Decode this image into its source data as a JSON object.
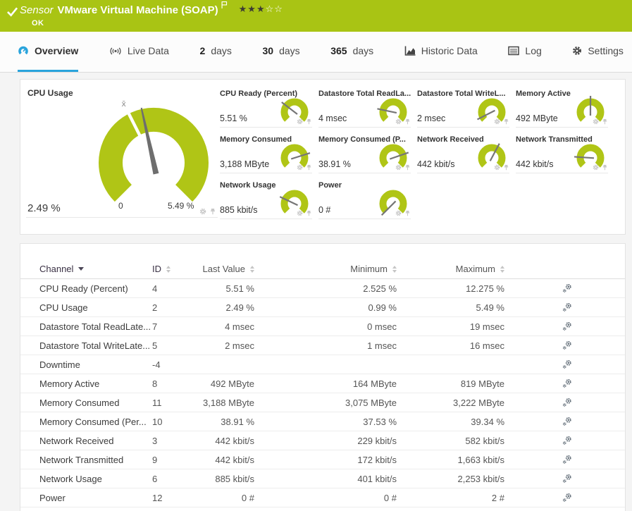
{
  "header": {
    "kind_label": "Sensor",
    "title": "VMware Virtual Machine (SOAP)",
    "status": "OK",
    "stars_filled": "★★★",
    "stars_empty": "☆☆",
    "priority": {
      "filled": 3,
      "total": 5
    }
  },
  "tabs": [
    {
      "label": "Overview",
      "icon": "gauge-icon",
      "active": true
    },
    {
      "label": "Live Data",
      "icon": "broadcast-icon",
      "active": false
    },
    {
      "prefix": "2",
      "label": "days",
      "active": false
    },
    {
      "prefix": "30",
      "label": "days",
      "active": false
    },
    {
      "prefix": "365",
      "label": "days",
      "active": false
    },
    {
      "label": "Historic Data",
      "icon": "area-chart-icon",
      "active": false
    },
    {
      "label": "Log",
      "icon": "log-icon",
      "active": false
    },
    {
      "label": "Settings",
      "icon": "gear-icon",
      "active": false
    }
  ],
  "gauges": {
    "main": {
      "label": "CPU Usage",
      "value": "2.49 %",
      "value_num": 2.49,
      "min": 0,
      "max": 5.49,
      "min_label": "0",
      "max_label": "5.49 %",
      "mean": 2.2,
      "mean_label": "x̄"
    },
    "minis": [
      {
        "label": "CPU Ready (Percent)",
        "value": "5.51 %",
        "value_num": 5.51,
        "min": 2.525,
        "max": 12.275
      },
      {
        "label": "Datastore Total ReadLa...",
        "value": "4 msec",
        "value_num": 4,
        "min": 0,
        "max": 19
      },
      {
        "label": "Datastore Total WriteL...",
        "value": "2 msec",
        "value_num": 2,
        "min": 1,
        "max": 16
      },
      {
        "label": "Memory Active",
        "value": "492 MByte",
        "value_num": 492,
        "min": 164,
        "max": 819
      },
      {
        "label": "Memory Consumed",
        "value": "3,188 MByte",
        "value_num": 3188,
        "min": 3075,
        "max": 3222
      },
      {
        "label": "Memory Consumed (P...",
        "value": "38.91 %",
        "value_num": 38.91,
        "min": 37.53,
        "max": 39.34
      },
      {
        "label": "Network Received",
        "value": "442 kbit/s",
        "value_num": 442,
        "min": 229,
        "max": 582
      },
      {
        "label": "Network Transmitted",
        "value": "442 kbit/s",
        "value_num": 442,
        "min": 172,
        "max": 1663
      },
      {
        "label": "Network Usage",
        "value": "885 kbit/s",
        "value_num": 885,
        "min": 401,
        "max": 2253
      },
      {
        "label": "Power",
        "value": "0 #",
        "value_num": 0,
        "min": 0,
        "max": 2
      }
    ]
  },
  "table": {
    "columns": [
      {
        "label": "Channel",
        "sort": "desc"
      },
      {
        "label": "ID",
        "sort": "both"
      },
      {
        "label": "Last Value",
        "sort": "both"
      },
      {
        "label": "Minimum",
        "sort": "both"
      },
      {
        "label": "Maximum",
        "sort": "both"
      }
    ],
    "rows": [
      {
        "channel": "CPU Ready (Percent)",
        "id": "4",
        "last": "5.51 %",
        "min": "2.525 %",
        "max": "12.275 %"
      },
      {
        "channel": "CPU Usage",
        "id": "2",
        "last": "2.49 %",
        "min": "0.99 %",
        "max": "5.49 %"
      },
      {
        "channel": "Datastore Total ReadLate...",
        "id": "7",
        "last": "4 msec",
        "min": "0 msec",
        "max": "19 msec"
      },
      {
        "channel": "Datastore Total WriteLate...",
        "id": "5",
        "last": "2 msec",
        "min": "1 msec",
        "max": "16 msec"
      },
      {
        "channel": "Downtime",
        "id": "-4",
        "last": "",
        "min": "",
        "max": ""
      },
      {
        "channel": "Memory Active",
        "id": "8",
        "last": "492 MByte",
        "min": "164 MByte",
        "max": "819 MByte"
      },
      {
        "channel": "Memory Consumed",
        "id": "11",
        "last": "3,188 MByte",
        "min": "3,075 MByte",
        "max": "3,222 MByte"
      },
      {
        "channel": "Memory Consumed (Per...",
        "id": "10",
        "last": "38.91 %",
        "min": "37.53 %",
        "max": "39.34 %"
      },
      {
        "channel": "Network Received",
        "id": "3",
        "last": "442 kbit/s",
        "min": "229 kbit/s",
        "max": "582 kbit/s"
      },
      {
        "channel": "Network Transmitted",
        "id": "9",
        "last": "442 kbit/s",
        "min": "172 kbit/s",
        "max": "1,663 kbit/s"
      },
      {
        "channel": "Network Usage",
        "id": "6",
        "last": "885 kbit/s",
        "min": "401 kbit/s",
        "max": "2,253 kbit/s"
      },
      {
        "channel": "Power",
        "id": "12",
        "last": "0 #",
        "min": "0 #",
        "max": "2 #"
      }
    ]
  },
  "icons": {
    "tile_actions": [
      "gear-icon",
      "pin-icon"
    ],
    "row_action": "channel-settings-icon"
  },
  "colors": {
    "header_green": "#a9c414",
    "gauge_green": "#b0c516",
    "active_tab_blue": "#2aa4dc"
  }
}
